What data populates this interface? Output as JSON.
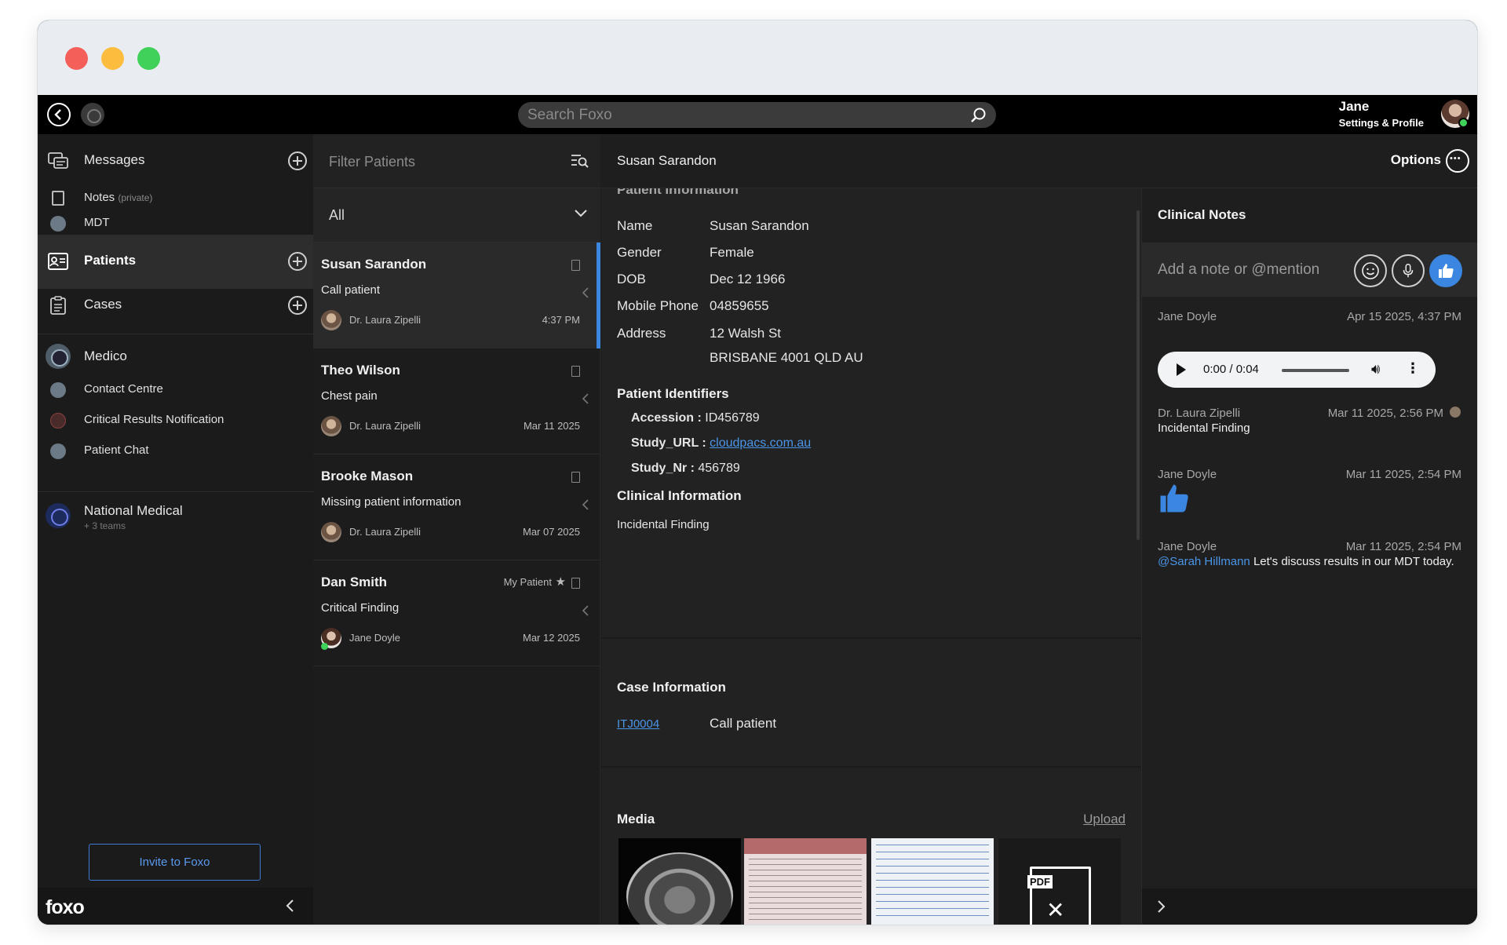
{
  "app": {
    "brand": "foxo"
  },
  "topbar": {
    "search_placeholder": "Search Foxo",
    "user_name": "Jane",
    "user_sub": "Settings & Profile"
  },
  "sidebar": {
    "messages": "Messages",
    "notes": "Notes",
    "notes_private": "(private)",
    "mdt": "MDT",
    "patients": "Patients",
    "cases": "Cases",
    "org1": "Medico",
    "org1_items": [
      "Contact Centre",
      "Critical Results Notification",
      "Patient Chat"
    ],
    "org2": "National Medical",
    "org2_sub": "+ 3 teams",
    "invite": "Invite to Foxo"
  },
  "patient_list": {
    "filter_placeholder": "Filter Patients",
    "filter_value": "All",
    "patients": [
      {
        "name": "Susan Sarandon",
        "reason": "Call patient",
        "doctor": "Dr. Laura Zipelli",
        "date": "4:37 PM"
      },
      {
        "name": "Theo Wilson",
        "reason": "Chest pain",
        "doctor": "Dr. Laura Zipelli",
        "date": "Mar 11 2025"
      },
      {
        "name": "Brooke Mason",
        "reason": "Missing patient information",
        "doctor": "Dr. Laura Zipelli",
        "date": "Mar 07 2025"
      },
      {
        "name": "Dan Smith",
        "reason": "Critical Finding",
        "doctor": "Jane Doyle",
        "date": "Mar 12 2025",
        "tag": "My Patient"
      }
    ]
  },
  "detail": {
    "title": "Susan Sarandon",
    "options": "Options",
    "section_cut": "Patient Information",
    "fields": {
      "name_k": "Name",
      "name_v": "Susan Sarandon",
      "gender_k": "Gender",
      "gender_v": "Female",
      "dob_k": "DOB",
      "dob_v": "Dec 12 1966",
      "phone_k": "Mobile Phone",
      "phone_v": "04859655",
      "address_k": "Address",
      "address_v1": "12 Walsh St",
      "address_v2": "BRISBANE 4001 QLD AU"
    },
    "identifiers_title": "Patient Identifiers",
    "accession_k": "Accession :",
    "accession_v": "ID456789",
    "study_url_k": "Study_URL :",
    "study_url_v": "cloudpacs.com.au",
    "study_nr_k": "Study_Nr :",
    "study_nr_v": "456789",
    "clinical_title": "Clinical Information",
    "clinical_text": "Incidental Finding",
    "case_title": "Case Information",
    "case_id": "ITJ0004",
    "case_value": "Call patient",
    "media_title": "Media",
    "upload": "Upload",
    "pdf_tag": "PDF"
  },
  "notes": {
    "title": "Clinical Notes",
    "placeholder": "Add a note or @mention",
    "items": [
      {
        "author": "Jane Doyle",
        "date": "Apr 15 2025, 4:37 PM",
        "audio_time": "0:00 / 0:04"
      },
      {
        "author": "Dr. Laura Zipelli",
        "date": "Mar 11 2025, 2:56 PM",
        "text": "Incidental Finding"
      },
      {
        "author": "Jane Doyle",
        "date": "Mar 11 2025, 2:54 PM"
      },
      {
        "author": "Jane Doyle",
        "date": "Mar 11 2025, 2:54 PM",
        "mention": "@Sarah Hillmann",
        "text": " Let's discuss results in our MDT today."
      }
    ]
  },
  "colors": {
    "accent": "#3a86e0",
    "link": "#4a95e8",
    "bg": "#1e1e1e"
  }
}
